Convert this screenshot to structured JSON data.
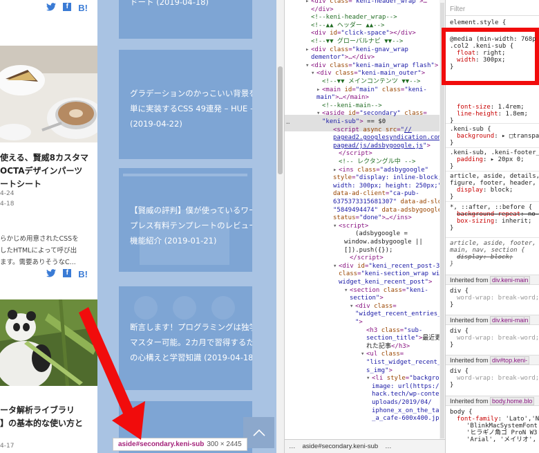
{
  "blog": {
    "share": {
      "twitter": "𝕐",
      "facebook": "f",
      "hatena": "B!"
    },
    "post1": {
      "title_lines": [
        "使える、賢威8カスタマ",
        "OCTAデザインパーツ",
        "ートシート"
      ],
      "dates": [
        "4-24",
        "4-18"
      ],
      "excerpt_lines": [
        "らかじめ用意されたCSSを",
        "したHTMLによって呼び出",
        "ます。需要ありそうなC..."
      ]
    },
    "post2": {
      "title_lines": [
        "ータ解析ライブラリ",
        "】の基本的な使い方と"
      ],
      "date": "4-17"
    }
  },
  "aside": {
    "cards": [
      {
        "lines": [
          "ドート (2019-04-18)"
        ]
      },
      {
        "lines": [
          "グラデーションのかっこいい背景を簡",
          "単に実装するCSS 49連発 – HUE –",
          "(2019-04-22)"
        ]
      },
      {
        "lines": [
          "【賢威の評判】僕が使っているワード",
          "プレス有料テンプレートのレビューと",
          "機能紹介 (2019-01-21)"
        ]
      },
      {
        "lines": [
          "断言します！プログラミングは独学で",
          "マスター可能。2カ月で習得するため",
          "の心構えと学習知識 (2019-04-18)"
        ]
      }
    ],
    "totop_icon": "︿"
  },
  "tooltip": {
    "selector": "aside#secondary.keni-sub",
    "dims": "300 × 2445"
  },
  "elements": {
    "lines": [
      {
        "indent": 18,
        "html": "<span class='tri'>▸</span><span class='tag'>&lt;div </span><span class='attr'>class</span><span class='tag'>=</span><span class='val'>\"keni-header_wrap\"</span><span class='tag'>&gt;…</span>"
      },
      {
        "indent": 26,
        "html": "<span class='tag'>&lt;/div&gt;</span>"
      },
      {
        "indent": 26,
        "html": "<span class='cm'>&lt;!--keni-header_wrap--&gt;</span>"
      },
      {
        "indent": 26,
        "html": "<span class='cm'>&lt;!--▲▲ ヘッダー ▲▲--&gt;</span>"
      },
      {
        "indent": 26,
        "html": "<span class='tag'>&lt;div </span><span class='attr'>id</span><span class='tag'>=</span><span class='val'>\"click-space\"</span><span class='tag'>&gt;&lt;/div&gt;</span>"
      },
      {
        "indent": 26,
        "html": "<span class='cm'>&lt;!--▼▼ グローバルナビ ▼▼--&gt;</span>"
      },
      {
        "indent": 18,
        "html": "<span class='tri'>▸</span><span class='tag'>&lt;div </span><span class='attr'>class</span><span class='tag'>=</span><span class='val'>\"keni-gnav_wrap</span>"
      },
      {
        "indent": 26,
        "html": "<span class='val'>dementor\"</span><span class='tag'>&gt;…&lt;/div&gt;</span>"
      },
      {
        "indent": 18,
        "html": "<span class='tri'>▾</span><span class='tag'>&lt;div </span><span class='attr'>class</span><span class='tag'>=</span><span class='val'>\"keni-main_wrap flash\"</span><span class='tag'>&gt;</span>"
      },
      {
        "indent": 26,
        "html": "<span class='tri'>▾</span><span class='tag'>&lt;div </span><span class='attr'>class</span><span class='tag'>=</span><span class='val'>\"keni-main_outer\"</span><span class='tag'>&gt;</span>"
      },
      {
        "indent": 42,
        "html": "<span class='cm'>&lt;!--▼▼ メインコンテンツ ▼▼--&gt;</span>"
      },
      {
        "indent": 34,
        "html": "<span class='tri'>▸</span><span class='tag'>&lt;main </span><span class='attr'>id</span><span class='tag'>=</span><span class='val'>\"main\"</span><span class='attr'> class</span><span class='tag'>=</span><span class='val'>\"keni-</span>"
      },
      {
        "indent": 34,
        "html": "<span class='val'>main\"</span><span class='tag'>&gt;…&lt;/main&gt;</span>"
      },
      {
        "indent": 42,
        "html": "<span class='cm'>&lt;!--keni-main--&gt;</span>"
      },
      {
        "indent": 34,
        "html": "<span class='tri'>▾</span><span class='tag'>&lt;aside </span><span class='attr'>id</span><span class='tag'>=</span><span class='val'>\"secondary\"</span><span class='attr'> class</span><span class='tag'>=</span>"
      },
      {
        "indent": 42,
        "html": "<span class='val'>\"keni-sub\"</span><span class='tag'>&gt;</span><span class='txt'> == $0</span>"
      },
      {
        "indent": 58,
        "html": "<span class='tag'>&lt;script </span><span class='attr'>async src</span><span class='tag'>=</span><span class='val'>\"</span><span class='url'>//</span>"
      },
      {
        "indent": 58,
        "html": "<span class='url'>pagead2.googlesyndication.com/</span>"
      },
      {
        "indent": 58,
        "html": "<span class='url'>pagead/js/adsbygoogle.js</span><span class='val'>\"</span><span class='tag'>&gt;</span>"
      },
      {
        "indent": 66,
        "html": "<span class='tag'>&lt;/script&gt;</span>"
      },
      {
        "indent": 66,
        "html": "<span class='cm'>&lt;!-- レクタングル中 --&gt;</span>"
      },
      {
        "indent": 58,
        "html": "<span class='tri'>▸</span><span class='tag'>&lt;ins </span><span class='attr'>class</span><span class='tag'>=</span><span class='val'>\"adsbygoogle\"</span>"
      },
      {
        "indent": 58,
        "html": "<span class='attr'>style</span><span class='tag'>=</span><span class='val'>\"display: inline-block;</span>"
      },
      {
        "indent": 58,
        "html": "<span class='val'>width: 300px; height: 250px;\"</span>"
      },
      {
        "indent": 58,
        "html": "<span class='attr'>data-ad-client</span><span class='tag'>=</span><span class='val'>\"ca-pub-</span>"
      },
      {
        "indent": 58,
        "html": "<span class='val'>6375373315681307\"</span><span class='attr'> data-ad-slot</span><span class='tag'>=</span>"
      },
      {
        "indent": 58,
        "html": "<span class='val'>\"5849494474\"</span><span class='attr'> data-adsbygoogle-</span>"
      },
      {
        "indent": 58,
        "html": "<span class='attr'>status</span><span class='tag'>=</span><span class='val'>\"done\"</span><span class='tag'>&gt;…&lt;/ins&gt;</span>"
      },
      {
        "indent": 58,
        "html": "<span class='tri'>▾</span><span class='tag'>&lt;script&gt;</span>"
      },
      {
        "indent": 90,
        "html": "<span class='txt'>(adsbygoogle =</span>"
      },
      {
        "indent": 74,
        "html": "<span class='txt'>window.adsbygoogle ||</span>"
      },
      {
        "indent": 74,
        "html": "<span class='txt'>[]).push({});</span>"
      },
      {
        "indent": 82,
        "html": "<span class='tag'>&lt;/script&gt;</span>"
      },
      {
        "indent": 58,
        "html": "<span class='tri'>▾</span><span class='tag'>&lt;div </span><span class='attr'>id</span><span class='tag'>=</span><span class='val'>\"keni_recent_post-3\"</span>"
      },
      {
        "indent": 66,
        "html": "<span class='attr'>class</span><span class='tag'>=</span><span class='val'>\"keni-section_wrap widget</span>"
      },
      {
        "indent": 66,
        "html": "<span class='val'>widget_keni_recent_post\"</span><span class='tag'>&gt;</span>"
      },
      {
        "indent": 74,
        "html": "<span class='tri'>▾</span><span class='tag'>&lt;section </span><span class='attr'>class</span><span class='tag'>=</span><span class='val'>\"keni-</span>"
      },
      {
        "indent": 82,
        "html": "<span class='val'>section\"</span><span class='tag'>&gt;</span>"
      },
      {
        "indent": 82,
        "html": "<span class='tri'>▾</span><span class='tag'>&lt;div </span><span class='attr'>class</span><span class='tag'>=</span>"
      },
      {
        "indent": 90,
        "html": "<span class='val'>\"widget_recent_entries_img03</span>"
      },
      {
        "indent": 90,
        "html": "<span class='val'>\"</span><span class='tag'>&gt;</span>"
      },
      {
        "indent": 106,
        "html": "<span class='tag'>&lt;h3 </span><span class='attr'>class</span><span class='tag'>=</span><span class='val'>\"sub-</span>"
      },
      {
        "indent": 106,
        "html": "<span class='val'>section_title\"</span><span class='tag'>&gt;</span><span class='txt'>最近更新さ</span>"
      },
      {
        "indent": 106,
        "html": "<span class='txt'>れた記事</span><span class='tag'>&lt;/h3&gt;</span>"
      },
      {
        "indent": 98,
        "html": "<span class='tri'>▾</span><span class='tag'>&lt;ul </span><span class='attr'>class</span><span class='tag'>=</span>"
      },
      {
        "indent": 106,
        "html": "<span class='val'>\"list_widget_recent_entrie</span>"
      },
      {
        "indent": 106,
        "html": "<span class='val'>s_img\"</span><span class='tag'>&gt;</span>"
      },
      {
        "indent": 106,
        "html": "<span class='tri'>▾</span><span class='tag'>&lt;li </span><span class='attr'>style</span><span class='tag'>=</span><span class='val'>\"background-</span>"
      },
      {
        "indent": 114,
        "html": "<span class='val'>image: url(https://lets-</span>"
      },
      {
        "indent": 114,
        "html": "<span class='val'>hack.tech/wp-content/</span>"
      },
      {
        "indent": 114,
        "html": "<span class='val'>uploads/2019/04/</span>"
      },
      {
        "indent": 114,
        "html": "<span class='val'>iphone_x_on_the_table_in</span>"
      },
      {
        "indent": 114,
        "html": "<span class='val'>_a_cafe-600x400.jpg);\"</span><span class='tag'>&gt;</span>"
      }
    ],
    "ellipsis": "…",
    "breadcrumb": [
      "…",
      "aside#secondary.keni-sub",
      "…"
    ]
  },
  "styles": {
    "filter_placeholder": "Filter",
    "element_style": "element.style {",
    "media_query": "@media (min-width: 768p",
    "media_selector": ".col2 .keni-sub {",
    "media_props": [
      [
        "float",
        "right;"
      ],
      [
        "width",
        "300px;"
      ]
    ],
    "rules": [
      {
        "props": [
          [
            "font-size",
            "1.4rem;"
          ],
          [
            "line-height",
            "1.8em;"
          ]
        ]
      },
      {
        "selector": ".keni-sub {",
        "props": [
          [
            "background",
            "▸ □transpar"
          ]
        ]
      },
      {
        "selector": ".keni-sub, .keni-footer_o",
        "props": [
          [
            "padding",
            "▸ 20px 0;"
          ]
        ]
      },
      {
        "selector": "article, aside, details,",
        "selector2": "figure, footer, header, ma",
        "props": [
          [
            "display",
            "block;"
          ]
        ]
      },
      {
        "selector": "*, ::after, ::before {",
        "props": [
          [
            "background-repeat",
            "no-"
          ],
          [
            "box-sizing",
            "inherit;"
          ]
        ]
      },
      {
        "selector": "article, aside, footer, he",
        "selector2": "main, nav, section {",
        "props": [
          [
            "display",
            "block;"
          ]
        ]
      }
    ],
    "inherited": [
      {
        "label": "Inherited from",
        "from": "div.keni-main",
        "selector": "div {",
        "prop": "word-wrap",
        "value": "break-word;"
      },
      {
        "label": "Inherited from",
        "from": "div.keni-main",
        "selector": "div {",
        "prop": "word-wrap",
        "value": "break-word;"
      },
      {
        "label": "Inherited from",
        "from": "div#top.keni-",
        "selector": "div {",
        "prop": "word-wrap",
        "value": "break-word;"
      },
      {
        "label": "Inherited from",
        "from": "body.home.blo",
        "selector": "body {",
        "prop": "font-family",
        "value": "'Lato','No",
        "extra": [
          "'BlinkMacSystemFont'",
          "'ヒラギノ角ゴ ProN W3",
          "'Arial', 'メイリオ',"
        ]
      }
    ]
  },
  "colors": {
    "highlight": "#a9c3e3",
    "card": "#7ea5d4",
    "annotation": "#f10c0c",
    "devtools_tag": "#881280"
  }
}
